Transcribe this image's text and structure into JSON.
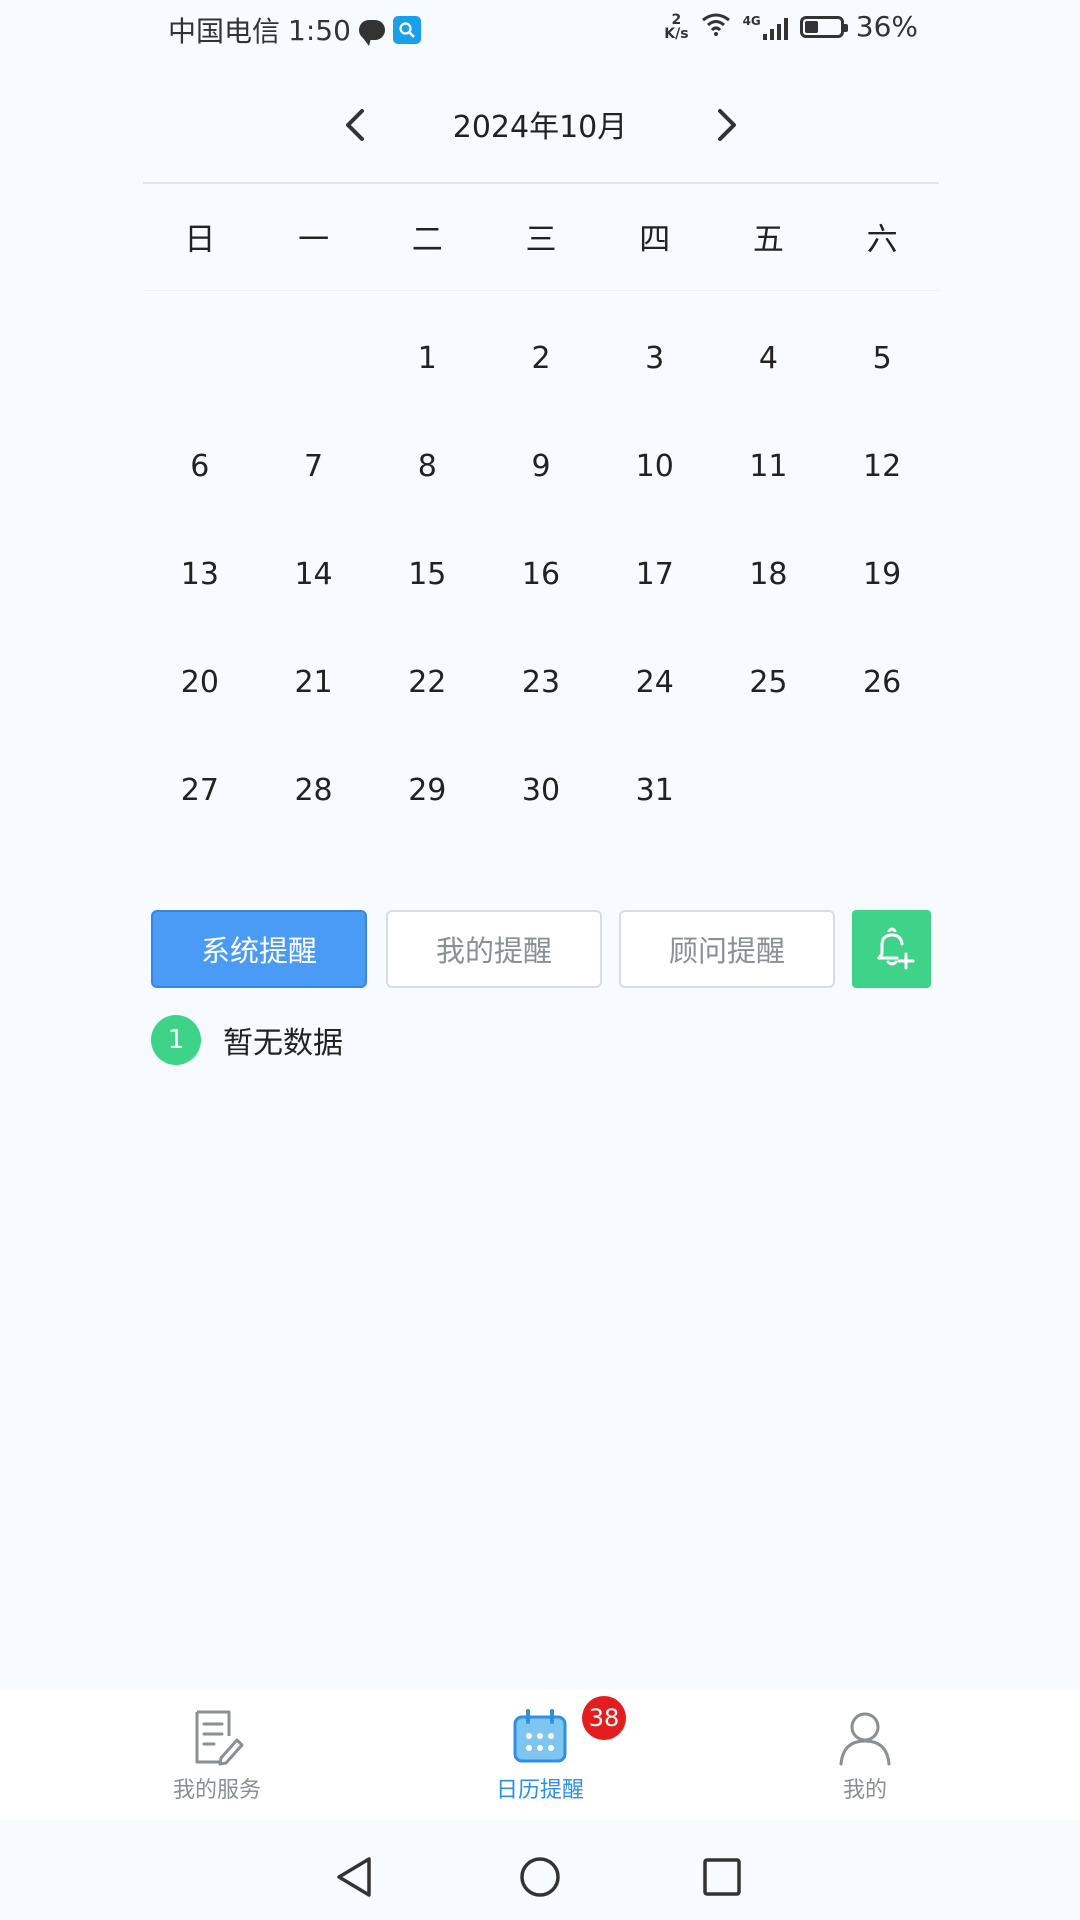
{
  "status_bar": {
    "carrier": "中国电信",
    "time": "1:50",
    "net_speed_value": "2",
    "net_speed_unit": "K/s",
    "network_type": "4G",
    "battery": "36%"
  },
  "calendar": {
    "month_title": "2024年10月",
    "weekdays": [
      "日",
      "一",
      "二",
      "三",
      "四",
      "五",
      "六"
    ],
    "days": [
      "",
      "",
      "1",
      "2",
      "3",
      "4",
      "5",
      "6",
      "7",
      "8",
      "9",
      "10",
      "11",
      "12",
      "13",
      "14",
      "15",
      "16",
      "17",
      "18",
      "19",
      "20",
      "21",
      "22",
      "23",
      "24",
      "25",
      "26",
      "27",
      "28",
      "29",
      "30",
      "31",
      "",
      ""
    ]
  },
  "tabs": {
    "system": "系统提醒",
    "mine": "我的提醒",
    "advisor": "顾问提醒",
    "active": "system"
  },
  "empty_state": {
    "index": "1",
    "text": "暂无数据"
  },
  "bottom_nav": {
    "items": [
      {
        "label": "我的服务",
        "icon": "document-edit-icon"
      },
      {
        "label": "日历提醒",
        "icon": "calendar-icon",
        "badge": "38",
        "active": true
      },
      {
        "label": "我的",
        "icon": "user-icon"
      }
    ]
  },
  "colors": {
    "accent_blue": "#4a9bf5",
    "accent_green": "#3fd38a",
    "badge_red": "#e41e1e",
    "active_nav": "#2f8fe0"
  }
}
